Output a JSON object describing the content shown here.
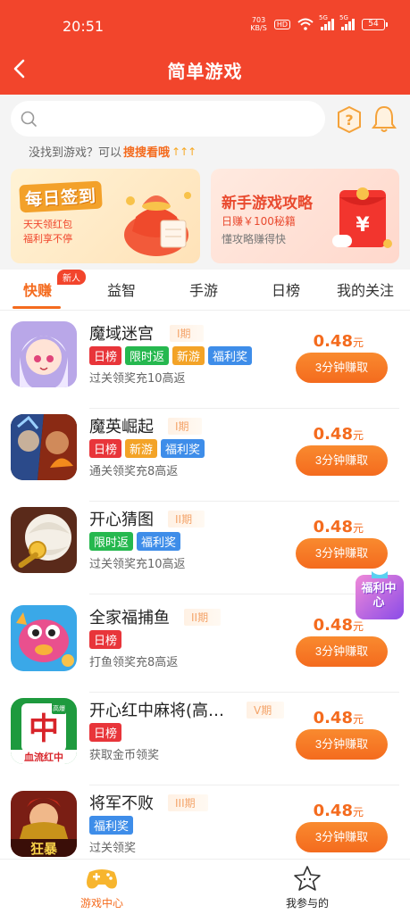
{
  "status_bar": {
    "time": "20:51",
    "net_speed_value": "703",
    "net_speed_unit": "KB/S",
    "hd": "HD",
    "signal1_label": "5G",
    "signal2_label": "5G",
    "battery": "54"
  },
  "header": {
    "title": "简单游戏"
  },
  "search": {
    "placeholder": "",
    "hint_prefix": "没找到游戏？可以",
    "hint_link": "搜搜看哦",
    "hint_arrows": "↑↑↑"
  },
  "banners": {
    "signin": {
      "title": "每日签到",
      "line1": "天天领红包",
      "line2": "福利享不停"
    },
    "guide": {
      "title": "新手游戏攻略",
      "line1": "日赚￥100秘籍",
      "line2": "懂攻略赚得快"
    }
  },
  "tabs": [
    {
      "label": "快赚",
      "active": true
    },
    {
      "label": "益智",
      "active": false
    },
    {
      "label": "手游",
      "active": false
    },
    {
      "label": "日榜",
      "active": false
    },
    {
      "label": "我的关注",
      "active": false
    }
  ],
  "new_badge": "新人",
  "games": [
    {
      "name": "魔域迷宫",
      "phase": "I期",
      "tags": [
        "日榜",
        "限时返",
        "新游",
        "福利奖"
      ],
      "desc": "过关领奖充10高返",
      "reward": "0.48",
      "unit": "元",
      "button": "3分钟赚取"
    },
    {
      "name": "魔英崛起",
      "phase": "I期",
      "tags": [
        "日榜",
        "新游",
        "福利奖"
      ],
      "desc": "通关领奖充8高返",
      "reward": "0.48",
      "unit": "元",
      "button": "3分钟赚取"
    },
    {
      "name": "开心猜图",
      "phase": "II期",
      "tags": [
        "限时返",
        "福利奖"
      ],
      "desc": "过关领奖充10高返",
      "reward": "0.48",
      "unit": "元",
      "button": "3分钟赚取"
    },
    {
      "name": "全家福捕鱼",
      "phase": "II期",
      "tags": [
        "日榜"
      ],
      "desc": "打鱼领奖充8高返",
      "reward": "0.48",
      "unit": "元",
      "button": "3分钟赚取"
    },
    {
      "name": "开心红中麻将(高…",
      "phase": "V期",
      "tags": [
        "日榜"
      ],
      "desc": "获取金币领奖",
      "reward": "0.48",
      "unit": "元",
      "button": "3分钟赚取"
    },
    {
      "name": "将军不败",
      "phase": "III期",
      "tags": [
        "福利奖"
      ],
      "desc": "过关领奖",
      "reward": "0.48",
      "unit": "元",
      "button": "3分钟赚取"
    }
  ],
  "icon_texts": {
    "mahjong_char": "中",
    "mahjong_top": "高爆",
    "mahjong_caption": "血流红中",
    "general_caption": "狂暴"
  },
  "welfare_float": "福利中心",
  "bottom_nav": [
    {
      "label": "游戏中心",
      "active": true
    },
    {
      "label": "我参与的",
      "active": false
    }
  ],
  "colors": {
    "brand_red": "#f2452c",
    "accent_orange": "#f46b1e",
    "tag_red": "#e8353a",
    "tag_green": "#26b84f",
    "tag_orange": "#f3a327",
    "tag_blue": "#3e8de9"
  }
}
